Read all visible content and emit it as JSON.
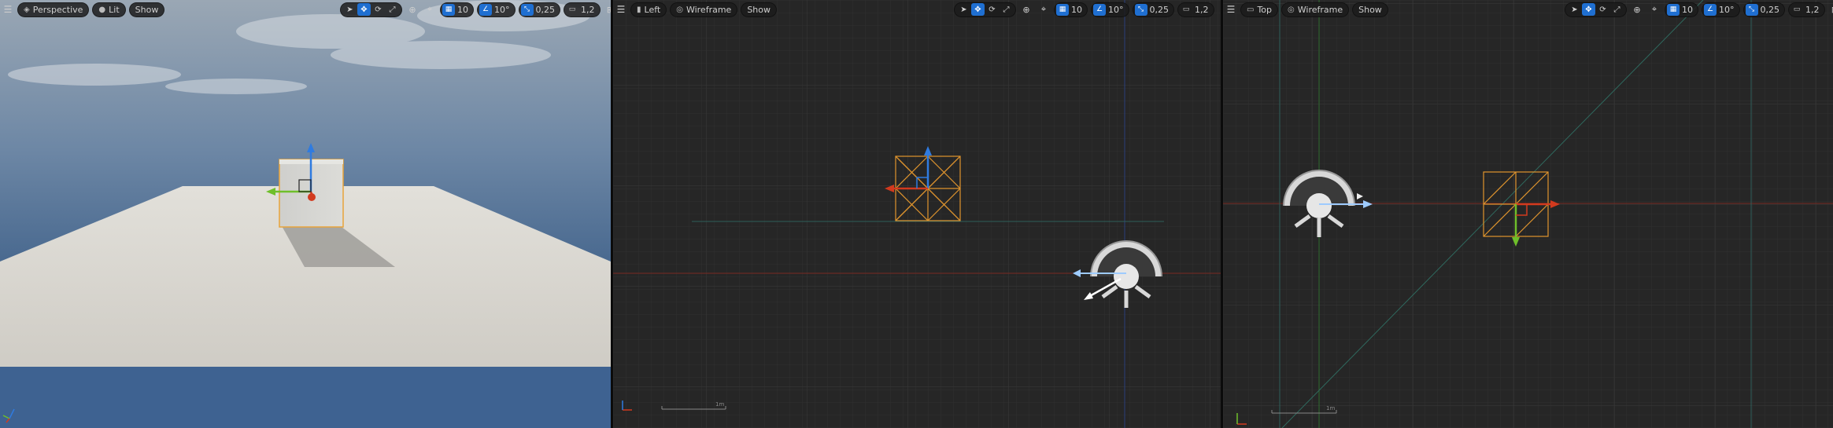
{
  "viewports": {
    "perspective": {
      "view_mode_label": "Perspective",
      "lighting_label": "Lit",
      "show_label": "Show",
      "grid_value": "10",
      "rotation_snap": "10°",
      "scale_snap": "0,25",
      "camera_speed": "1,2"
    },
    "left": {
      "view_mode_label": "Left",
      "lighting_label": "Wireframe",
      "show_label": "Show",
      "grid_value": "10",
      "rotation_snap": "10°",
      "scale_snap": "0,25",
      "camera_speed": "1,2",
      "scale_bar_label": "1m"
    },
    "top": {
      "view_mode_label": "Top",
      "lighting_label": "Wireframe",
      "show_label": "Show",
      "grid_value": "10",
      "rotation_snap": "10°",
      "scale_snap": "0,25",
      "camera_speed": "1,2",
      "scale_bar_label": "1m"
    }
  },
  "icons": {
    "menu": "hamburger-icon",
    "select": "cursor-icon",
    "translate": "move-icon",
    "rotate": "rotate-icon",
    "scale": "scale-icon",
    "world": "globe-icon",
    "surface_snap": "surface-snap-icon",
    "grid": "grid-icon",
    "angle": "angle-icon",
    "scale_snap": "scale-snap-icon",
    "camera": "camera-icon",
    "maximize": "maximize-icon"
  },
  "colors": {
    "accent": "#1f6fd1",
    "axis_x": "#d23a1e",
    "axis_y": "#6fbf2a",
    "axis_z": "#2f7be0",
    "selection": "#e8a43a",
    "grid_bg": "#262626"
  }
}
